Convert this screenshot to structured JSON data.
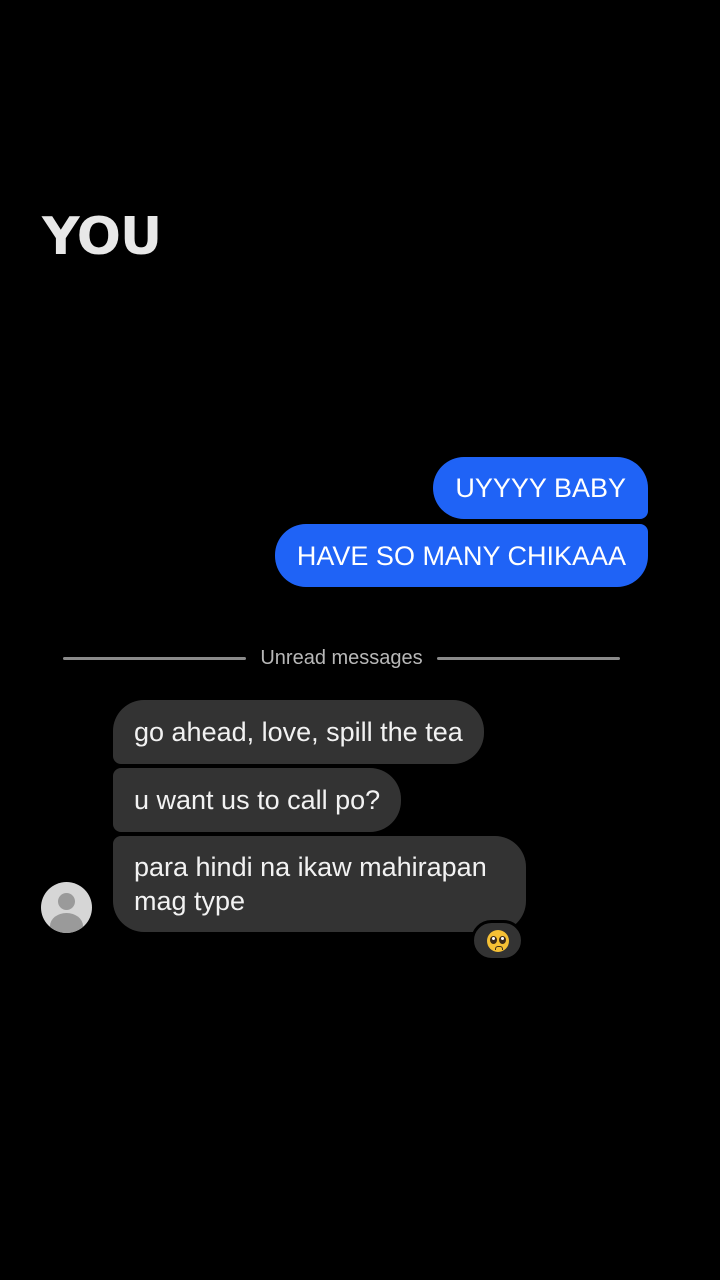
{
  "overlay": {
    "title": "YOU"
  },
  "messages": {
    "sent": [
      {
        "text": "UYYYY BABY"
      },
      {
        "text": "HAVE SO MANY CHIKAAA"
      }
    ],
    "divider": {
      "label": "Unread messages"
    },
    "received": [
      {
        "text": "go ahead, love, spill the tea"
      },
      {
        "text": "u want us to call po?"
      },
      {
        "text": "para hindi na ikaw mahirapan mag type"
      }
    ],
    "reaction": {
      "icon": "pleading-face-icon"
    }
  },
  "colors": {
    "background": "#000000",
    "sent_bubble": "#1f63f6",
    "received_bubble": "#333333",
    "divider_text": "#b8b8b8"
  }
}
